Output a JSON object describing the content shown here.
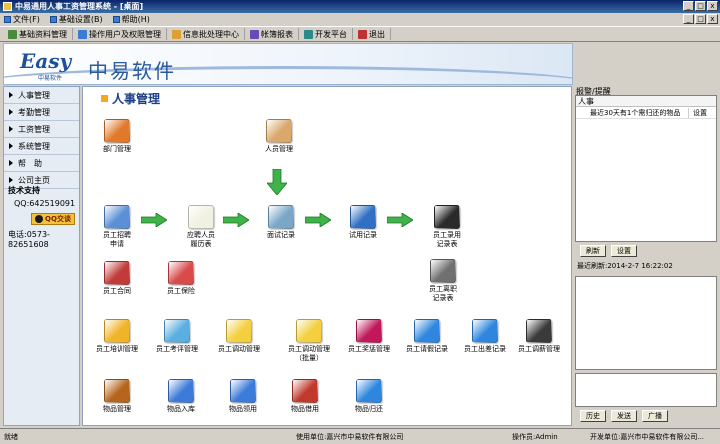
{
  "window": {
    "title": "中易通用人事工资管理系统 - [桌面]"
  },
  "menu": [
    {
      "label": "文件(F)",
      "icon": "file-icon"
    },
    {
      "label": "基础设置(B)",
      "icon": "settings-icon"
    },
    {
      "label": "帮助(H)",
      "icon": "help-icon"
    }
  ],
  "toolbar": [
    {
      "label": "基础资料管理",
      "icon": "home-icon",
      "color": "#4a8a3a"
    },
    {
      "label": "操作用户及权限管理",
      "icon": "users-icon",
      "color": "#3a7bd5"
    },
    {
      "label": "信息批处理中心",
      "icon": "document-icon",
      "color": "#e0a030"
    },
    {
      "label": "帐簿报表",
      "icon": "chart-icon",
      "color": "#6a4ab5"
    },
    {
      "label": "开发平台",
      "icon": "platform-icon",
      "color": "#2a8a8a"
    },
    {
      "label": "退出",
      "icon": "exit-icon",
      "color": "#c03030"
    }
  ],
  "banner": {
    "logo_text": "Easy",
    "logo_sub": "中易软件",
    "brand": "中易软件"
  },
  "sidebar": {
    "items": [
      "人事管理",
      "考勤管理",
      "工资管理",
      "系统管理",
      "帮　助",
      "公司主页"
    ],
    "support_title": "技术支持",
    "qq": "QQ:642519091",
    "chat_label": "QQ交谈",
    "phone": "电话:0573-82651608"
  },
  "main": {
    "title": "人事管理",
    "nodes": [
      {
        "label": "部门管理",
        "color": "#e07a2a"
      },
      {
        "label": "人员管理",
        "color": "#d9a86a"
      },
      {
        "label": "员工招聘\n申请",
        "color": "#5b8fd6"
      },
      {
        "label": "应聘人员\n履历表",
        "color": "#f1f1e2"
      },
      {
        "label": "面试记录",
        "color": "#7aa7c7"
      },
      {
        "label": "试用记录",
        "color": "#2f6fc4"
      },
      {
        "label": "员工录用\n记录表",
        "color": "#2a2a2a"
      },
      {
        "label": "员工合同",
        "color": "#c23a3a"
      },
      {
        "label": "员工保险",
        "color": "#d94a4a"
      },
      {
        "label": "员工离职\n记录表",
        "color": "#707070"
      },
      {
        "label": "员工培训管理",
        "color": "#f0b429"
      },
      {
        "label": "员工考评管理",
        "color": "#5aaee0"
      },
      {
        "label": "员工调动管理",
        "color": "#f4d03f"
      },
      {
        "label": "员工调动管理\n（批量）",
        "color": "#f4d03f"
      },
      {
        "label": "员工奖惩管理",
        "color": "#c2185b"
      },
      {
        "label": "员工请假记录",
        "color": "#2e86de"
      },
      {
        "label": "员工出差记录",
        "color": "#2e86de"
      },
      {
        "label": "员工调薪管理",
        "color": "#3a3a3a"
      },
      {
        "label": "物品管理",
        "color": "#b5651d"
      },
      {
        "label": "物品入库",
        "color": "#3d7bd9"
      },
      {
        "label": "物品领用",
        "color": "#3d7bd9"
      },
      {
        "label": "物品借用",
        "color": "#c0392b"
      },
      {
        "label": "物品归还",
        "color": "#2e86de"
      }
    ]
  },
  "right": {
    "alarm_title": "报警/提醒",
    "alarm_header": "人事",
    "alarm_row": {
      "text": "最近30天有1个需归还的物品",
      "action": "设置"
    },
    "refresh_label": "刷新",
    "settings_label": "设置",
    "refresh_time": "最近刷新:2014-2-7 16:22:02",
    "history_label": "历史",
    "send_label": "发送",
    "broadcast_label": "广播"
  },
  "status": {
    "state": "就绪",
    "user_unit": "使用单位:嘉兴市中易软件有限公司",
    "operator": "操作员:Admin",
    "dev_unit": "开发单位:嘉兴市中易软件有限公司..."
  }
}
